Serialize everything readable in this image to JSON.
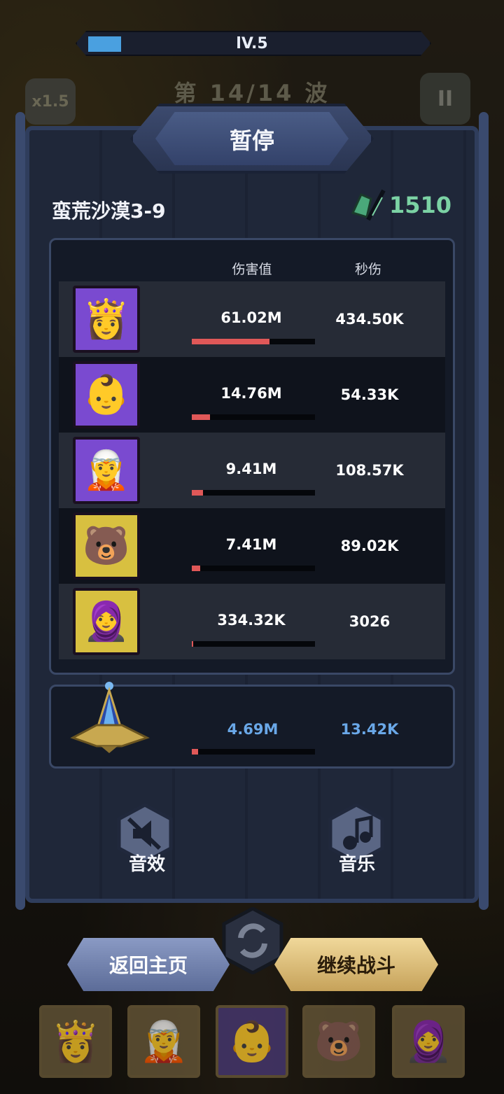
{
  "hud": {
    "level_text": "lV.5",
    "level_progress": 0.1,
    "wave_text": "第 14/14 波",
    "speed_label": "x1.5",
    "pause_symbol": "II"
  },
  "dialog": {
    "title": "暂停",
    "stage_name": "蛮荒沙漠3-9",
    "power_value": "1510",
    "headers": {
      "damage": "伤害值",
      "dps": "秒伤"
    },
    "heroes": [
      {
        "name": "golden-haired-hero",
        "glyph": "👸",
        "damage": "61.02M",
        "dps": "434.50K",
        "share": 0.63,
        "frame": "#7a4ad0"
      },
      {
        "name": "spirit-baby-hero",
        "glyph": "👶",
        "damage": "14.76M",
        "dps": "54.33K",
        "share": 0.15,
        "frame": "#7a4ad0"
      },
      {
        "name": "purple-haired-hero",
        "glyph": "🧝",
        "damage": "9.41M",
        "dps": "108.57K",
        "share": 0.09,
        "frame": "#7a4ad0"
      },
      {
        "name": "white-bear-hero",
        "glyph": "🐻",
        "damage": "7.41M",
        "dps": "89.02K",
        "share": 0.07,
        "frame": "#d8c040"
      },
      {
        "name": "nun-hero",
        "glyph": "🧕",
        "damage": "334.32K",
        "dps": "3026",
        "share": 0.01,
        "frame": "#d8c040"
      }
    ],
    "artifact": {
      "damage": "4.69M",
      "dps": "13.42K",
      "share": 0.05,
      "color": "#6aa8e8"
    },
    "controls": {
      "sound_label": "音效",
      "music_label": "音乐"
    },
    "buttons": {
      "home_label": "返回主页",
      "continue_label": "继续战斗"
    }
  },
  "team": [
    {
      "glyph": "👸"
    },
    {
      "glyph": "🧝"
    },
    {
      "glyph": "👶"
    },
    {
      "glyph": "🐻"
    },
    {
      "glyph": "🧕"
    }
  ]
}
